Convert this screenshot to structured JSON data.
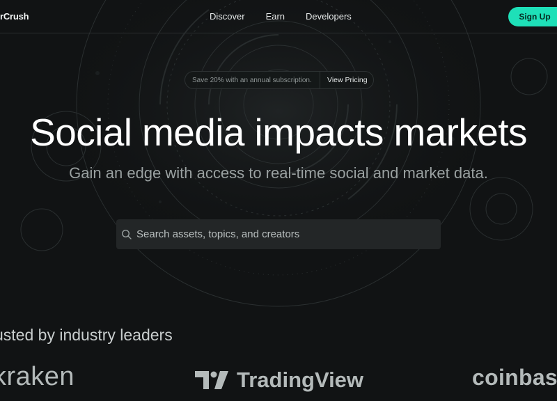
{
  "nav": {
    "brand": "rCrush",
    "links": [
      "Discover",
      "Earn",
      "Developers"
    ],
    "signup_label": "Sign Up"
  },
  "promo": {
    "text": "Save 20% with an annual subscription.",
    "link": "View Pricing"
  },
  "hero": {
    "title": "Social media impacts markets",
    "subtitle": "Gain an edge with access to real-time social and market data."
  },
  "search": {
    "placeholder": "Search assets, topics, and creators",
    "value": ""
  },
  "trusted": {
    "heading": "usted by industry leaders",
    "logos": [
      "kraken",
      "TradingView",
      "coinbas"
    ]
  },
  "colors": {
    "background": "#111314",
    "accent": "#1ee0b8",
    "search_bg": "#232627"
  },
  "icons": {
    "search": "search-icon",
    "tradingview_mark": "tradingview-logo-icon"
  }
}
